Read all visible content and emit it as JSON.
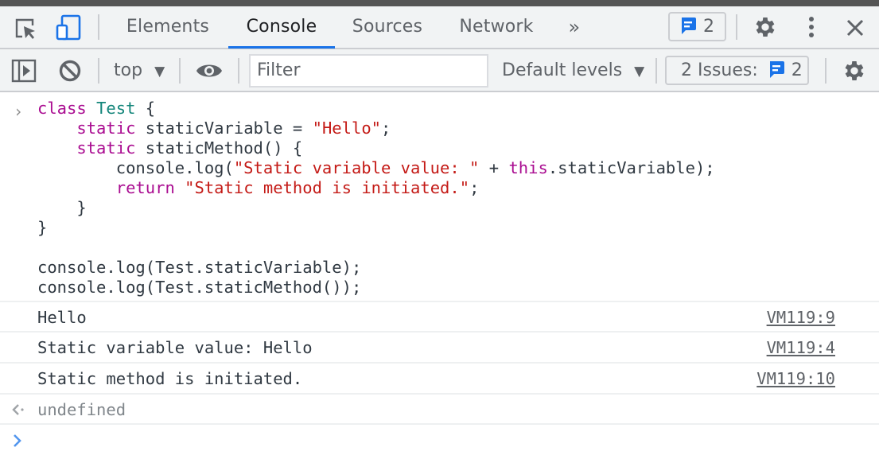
{
  "tabs": {
    "items": [
      {
        "label": "Elements",
        "active": false
      },
      {
        "label": "Console",
        "active": true
      },
      {
        "label": "Sources",
        "active": false
      },
      {
        "label": "Network",
        "active": false
      }
    ],
    "more_label": "»",
    "messages_count": "2",
    "icons": {
      "inspect": "inspect-element-icon",
      "device": "device-toolbar-icon",
      "settings": "gear-icon",
      "menu": "kebab-menu-icon",
      "close": "close-icon"
    }
  },
  "toolbar": {
    "context": "top",
    "filter_placeholder": "Filter",
    "levels": "Default levels",
    "issues_label": "2 Issues:",
    "issues_count": "2",
    "icons": {
      "sidebar": "show-sidebar-icon",
      "clear": "clear-console-icon",
      "live_expression": "eye-icon",
      "settings": "gear-icon"
    }
  },
  "console": {
    "input_code": [
      [
        [
          "kw",
          "class "
        ],
        [
          "cls",
          "Test"
        ],
        [
          "plain",
          " {"
        ]
      ],
      [
        [
          "plain",
          "    "
        ],
        [
          "kw",
          "static "
        ],
        [
          "plain",
          "staticVariable = "
        ],
        [
          "str",
          "\"Hello\""
        ],
        [
          "plain",
          ";"
        ]
      ],
      [
        [
          "plain",
          "    "
        ],
        [
          "kw",
          "static "
        ],
        [
          "plain",
          "staticMethod() {"
        ]
      ],
      [
        [
          "plain",
          "        console.log("
        ],
        [
          "str",
          "\"Static variable value: \""
        ],
        [
          "plain",
          " + "
        ],
        [
          "kw",
          "this"
        ],
        [
          "plain",
          ".staticVariable);"
        ]
      ],
      [
        [
          "plain",
          "        "
        ],
        [
          "kw",
          "return "
        ],
        [
          "str",
          "\"Static method is initiated.\""
        ],
        [
          "plain",
          ";"
        ]
      ],
      [
        [
          "plain",
          "    }"
        ]
      ],
      [
        [
          "plain",
          "}"
        ]
      ],
      [
        [
          "plain",
          ""
        ]
      ],
      [
        [
          "plain",
          "console.log(Test.staticVariable);"
        ]
      ],
      [
        [
          "plain",
          "console.log(Test.staticMethod());"
        ]
      ]
    ],
    "messages": [
      {
        "text": "Hello",
        "source": "VM119:9"
      },
      {
        "text": "Static variable value: Hello",
        "source": "VM119:4"
      },
      {
        "text": "Static method is initiated.",
        "source": "VM119:10"
      }
    ],
    "result": "undefined",
    "colors": {
      "keyword": "#aa0d91",
      "class_name": "#13857a",
      "string": "#c41a16",
      "accent": "#1a73e8"
    }
  }
}
